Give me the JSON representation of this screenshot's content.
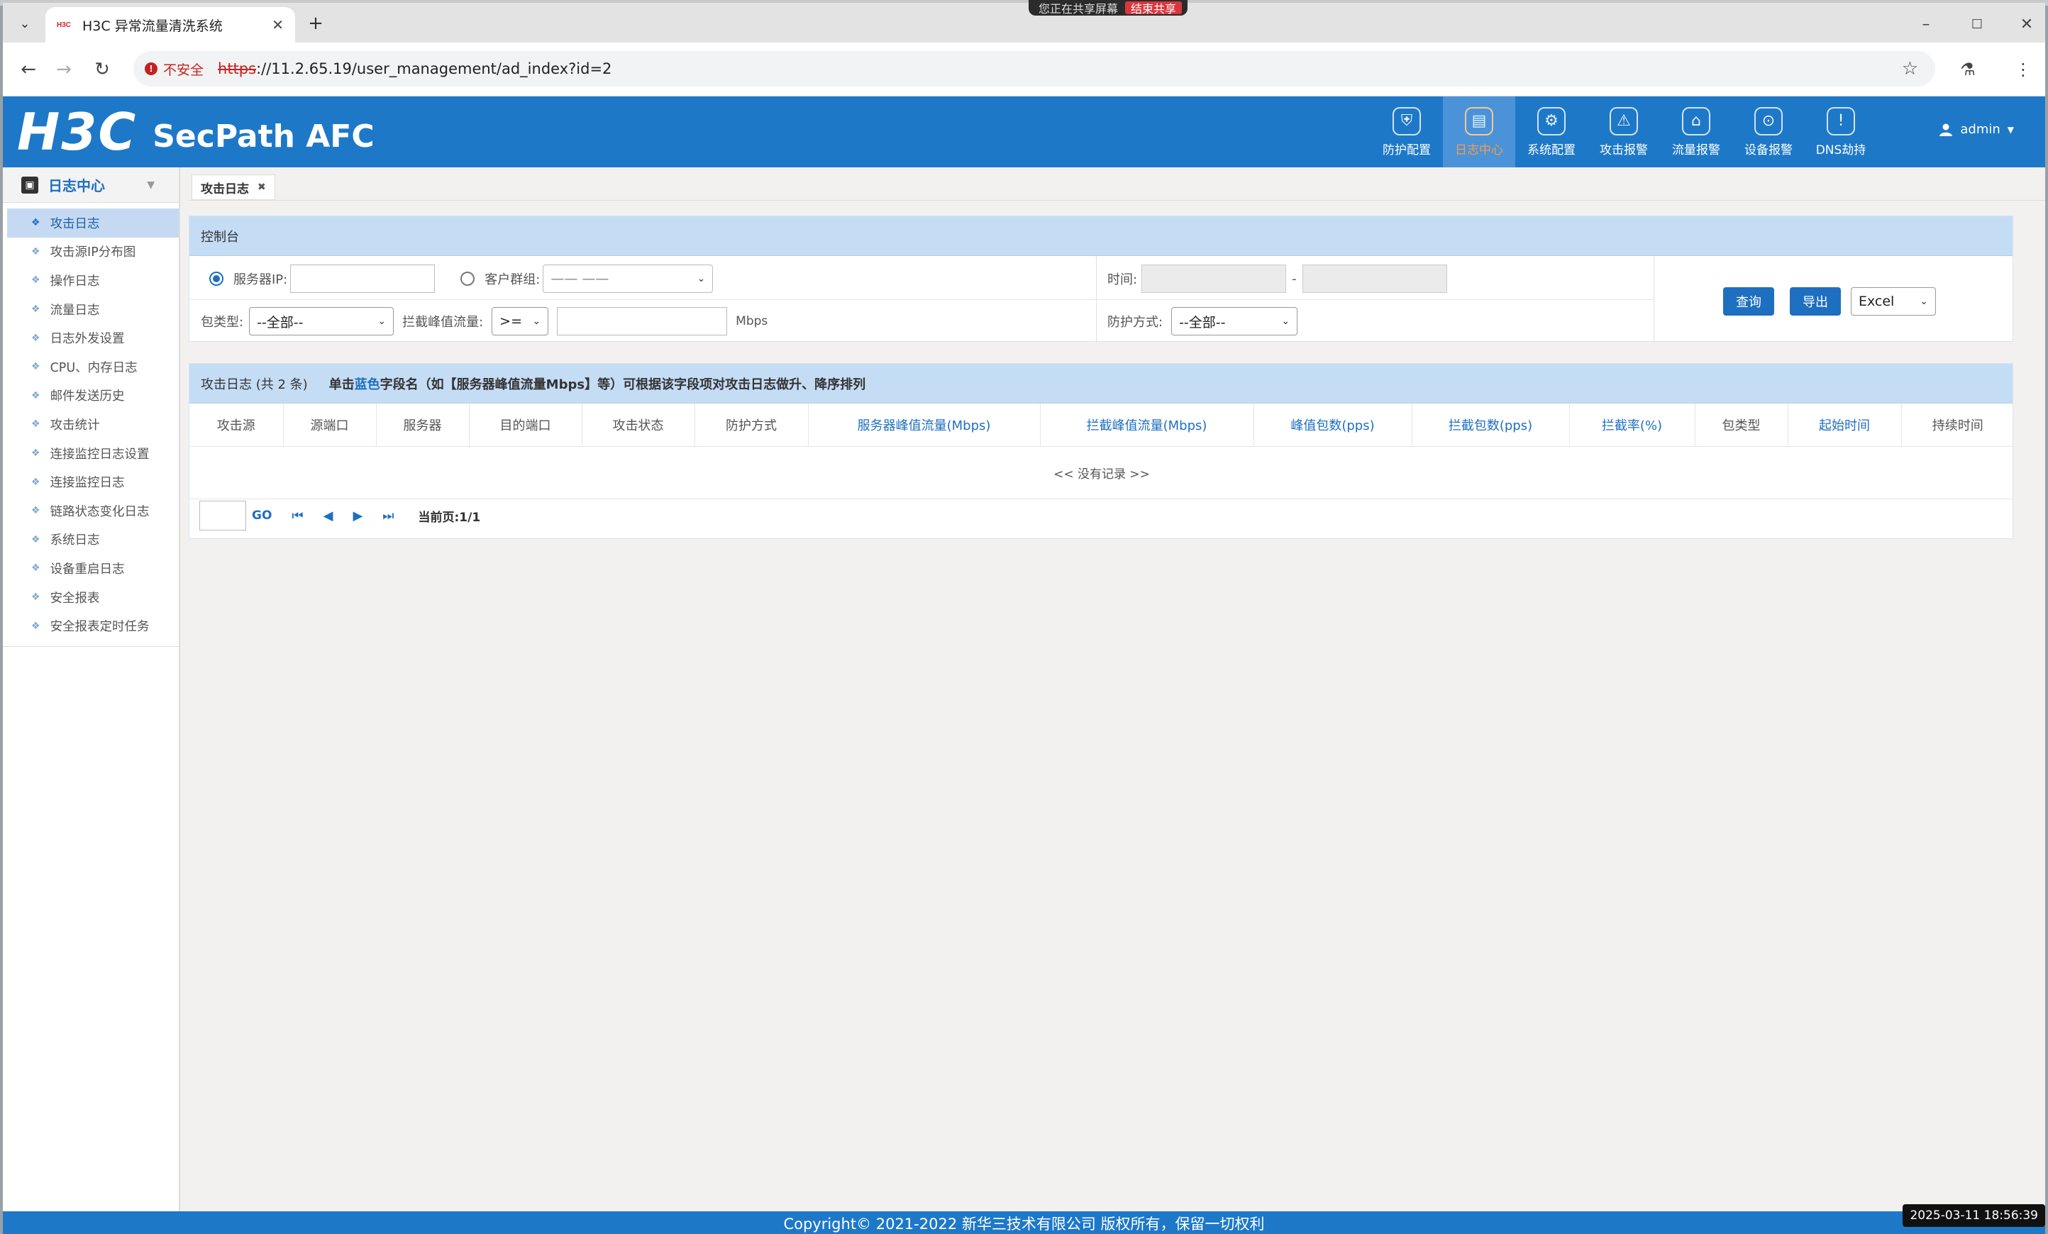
{
  "screen_share": {
    "text": "您正在共享屏幕",
    "stop_label": "结束共享"
  },
  "browser": {
    "tab_title": "H3C 异常流量清洗系统",
    "tab_favicon": "H3C",
    "security_label": "不安全",
    "url_scheme": "https",
    "url_rest": "://11.2.65.19/user_management/ad_index?id=2"
  },
  "header": {
    "brand": "H3C",
    "product": "SecPath AFC",
    "nav": [
      {
        "label": "防护配置",
        "icon": "shield-icon"
      },
      {
        "label": "日志中心",
        "icon": "log-icon",
        "active": true
      },
      {
        "label": "系统配置",
        "icon": "gear-icon"
      },
      {
        "label": "攻击报警",
        "icon": "alarm-icon"
      },
      {
        "label": "流量报警",
        "icon": "traffic-alarm-icon"
      },
      {
        "label": "设备报警",
        "icon": "device-alarm-icon"
      },
      {
        "label": "DNS劫持",
        "icon": "warning-icon"
      }
    ],
    "user": "admin"
  },
  "sidebar": {
    "title": "日志中心",
    "items": [
      {
        "label": "攻击日志",
        "active": true
      },
      {
        "label": "攻击源IP分布图"
      },
      {
        "label": "操作日志"
      },
      {
        "label": "流量日志"
      },
      {
        "label": "日志外发设置"
      },
      {
        "label": "CPU、内存日志"
      },
      {
        "label": "邮件发送历史"
      },
      {
        "label": "攻击统计"
      },
      {
        "label": "连接监控日志设置"
      },
      {
        "label": "连接监控日志"
      },
      {
        "label": "链路状态变化日志"
      },
      {
        "label": "系统日志"
      },
      {
        "label": "设备重启日志"
      },
      {
        "label": "安全报表"
      },
      {
        "label": "安全报表定时任务"
      }
    ]
  },
  "content": {
    "tab_label": "攻击日志",
    "console": {
      "title": "控制台",
      "server_ip_label": "服务器IP:",
      "customer_group_label": "客户群组:",
      "customer_group_value": "—— ——",
      "time_label": "时间:",
      "time_sep": "-",
      "packet_type_label": "包类型:",
      "packet_type_value": "--全部--",
      "peak_label": "拦截峰值流量:",
      "peak_op": ">=",
      "peak_unit": "Mbps",
      "protect_label": "防护方式:",
      "protect_value": "--全部--",
      "query_label": "查询",
      "export_label": "导出",
      "export_format": "Excel"
    },
    "log": {
      "title": "攻击日志 (共 2 条)",
      "hint_pre": "单击",
      "hint_blue": "蓝色",
      "hint_post": "字段名（如【服务器峰值流量Mbps】等）可根据该字段项对攻击日志做升、降序排列",
      "columns": [
        {
          "label": "攻击源",
          "sortable": false
        },
        {
          "label": "源端口",
          "sortable": false
        },
        {
          "label": "服务器",
          "sortable": false
        },
        {
          "label": "目的端口",
          "sortable": false
        },
        {
          "label": "攻击状态",
          "sortable": false
        },
        {
          "label": "防护方式",
          "sortable": false
        },
        {
          "label": "服务器峰值流量(Mbps)",
          "sortable": true
        },
        {
          "label": "拦截峰值流量(Mbps)",
          "sortable": true
        },
        {
          "label": "峰值包数(pps)",
          "sortable": true
        },
        {
          "label": "拦截包数(pps)",
          "sortable": true
        },
        {
          "label": "拦截率(%)",
          "sortable": true
        },
        {
          "label": "包类型",
          "sortable": false
        },
        {
          "label": "起始时间",
          "sortable": true
        },
        {
          "label": "持续时间",
          "sortable": false
        }
      ],
      "empty_text": "<< 没有记录 >>",
      "pager": {
        "go_label": "GO",
        "current_page": "当前页:1/1"
      }
    }
  },
  "footer": {
    "copyright": "Copyright© 2021-2022 新华三技术有限公司 版权所有，保留一切权利"
  },
  "clock": "2025-03-11 18:56:39"
}
